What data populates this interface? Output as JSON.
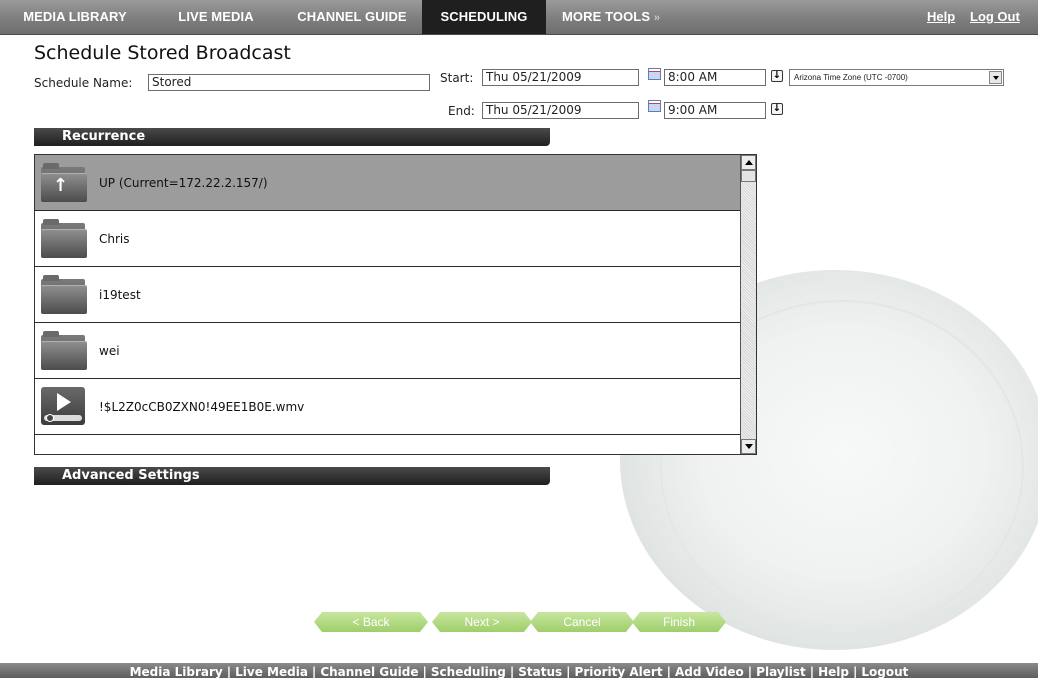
{
  "nav": {
    "tabs": [
      {
        "label": "MEDIA LIBRARY"
      },
      {
        "label": "LIVE MEDIA"
      },
      {
        "label": "CHANNEL GUIDE"
      },
      {
        "label": "SCHEDULING",
        "active": true
      },
      {
        "label": "MORE TOOLS"
      }
    ],
    "more_tools_arrow": "»",
    "help": "Help",
    "logout": "Log Out"
  },
  "page": {
    "title": "Schedule Stored Broadcast"
  },
  "form": {
    "schedule_name_label": "Schedule Name:",
    "schedule_name_value": "Stored",
    "start_label": "Start:",
    "start_date": "Thu 05/21/2009",
    "start_time": "8:00 AM",
    "end_label": "End:",
    "end_date": "Thu 05/21/2009",
    "end_time": "9:00 AM",
    "timezone": "Arizona Time Zone (UTC -0700)"
  },
  "sections": {
    "recurrence": "Recurrence",
    "advanced": "Advanced Settings"
  },
  "files": [
    {
      "type": "up",
      "name": "UP (Current=172.22.2.157/)"
    },
    {
      "type": "folder",
      "name": "Chris"
    },
    {
      "type": "folder",
      "name": "i19test"
    },
    {
      "type": "folder",
      "name": "wei"
    },
    {
      "type": "video",
      "name": "!$L2Z0cCB0ZXN0!49EE1B0E.wmv"
    }
  ],
  "wizard": {
    "back": "< Back",
    "next": "Next >",
    "cancel": "Cancel",
    "finish": "Finish"
  },
  "footer": {
    "links": [
      "Media Library",
      "Live Media",
      "Channel Guide",
      "Scheduling",
      "Status",
      "Priority Alert",
      "Add Video",
      "Playlist",
      "Help",
      "Logout"
    ]
  },
  "colors": {
    "nav_bg": "#7e7e7e",
    "nav_active": "#1f1f1f",
    "wizard_button": "#a8d474",
    "section_bar": "#2a2a2a"
  }
}
